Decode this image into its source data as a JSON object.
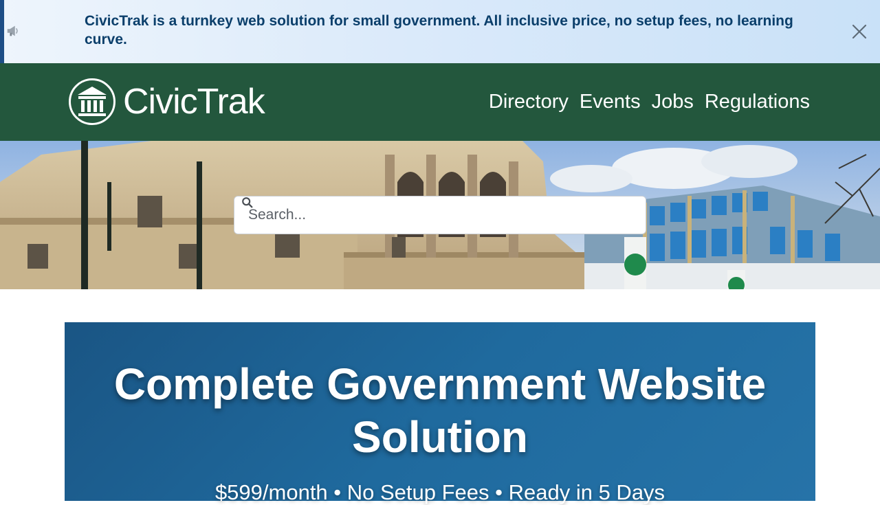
{
  "banner": {
    "text": "CivicTrak is a turnkey web solution for small government. All inclusive price, no setup fees, no learning curve.",
    "icon": "megaphone-icon",
    "close_icon": "close-icon"
  },
  "header": {
    "logo_icon": "building-columns-icon",
    "logo_text": "CivicTrak",
    "nav": [
      "Directory",
      "Events",
      "Jobs",
      "Regulations"
    ]
  },
  "hero": {
    "search_placeholder": "Search...",
    "search_value": "",
    "search_icon": "search-icon"
  },
  "promo": {
    "title": "Complete Government Website Solution",
    "subtitle": "$599/month • No Setup Fees • Ready in 5 Days"
  },
  "colors": {
    "header_green": "#23573d",
    "banner_text": "#0b3f6b",
    "promo_blue": "#1f6a9e"
  }
}
